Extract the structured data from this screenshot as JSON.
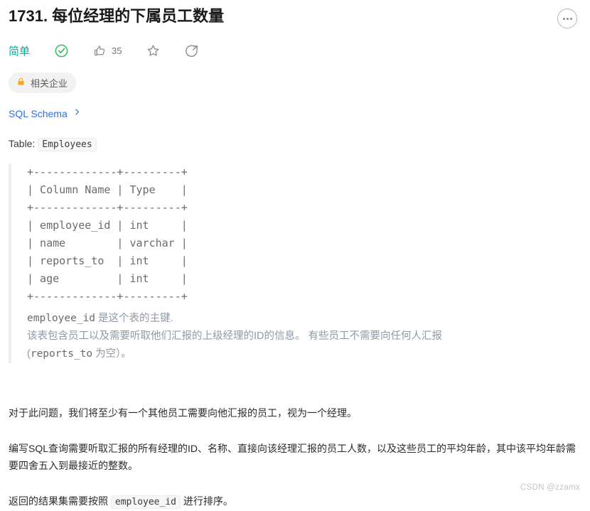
{
  "header": {
    "title": "1731. 每位经理的下属员工数量",
    "more_icon": "more-options-icon"
  },
  "action_bar": {
    "difficulty": "简单",
    "solved_icon": "check-circle-icon",
    "like_icon": "thumbs-up-icon",
    "like_count": "35",
    "favorite_icon": "star-icon",
    "share_icon": "share-icon"
  },
  "company_tag": {
    "lock_icon": "lock-icon",
    "label": "相关企业"
  },
  "schema_link": {
    "label": "SQL Schema",
    "chevron_icon": "chevron-right-icon"
  },
  "table_section": {
    "label": "Table:",
    "table_name": "Employees",
    "ascii_table": "+-------------+---------+\n| Column Name | Type    |\n+-------------+---------+\n| employee_id | int     |\n| name        | varchar |\n| reports_to  | int     |\n| age         | int     |\n+-------------+---------+",
    "note_line1_code": "employee_id",
    "note_line1_text": " 是这个表的主键.",
    "note_line2": "该表包含员工以及需要听取他们汇报的上级经理的ID的信息。  有些员工不需要向任何人汇报",
    "note_line3_prefix": "(",
    "note_line3_code": "reports_to",
    "note_line3_suffix": " 为空）。"
  },
  "description": {
    "paragraph1": "对于此问题，我们将至少有一个其他员工需要向他汇报的员工，视为一个经理。",
    "paragraph2": "编写SQL查询需要听取汇报的所有经理的ID、名称、直接向该经理汇报的员工人数，以及这些员工的平均年龄，其中该平均年龄需要四舍五入到最接近的整数。",
    "paragraph3_prefix": "返回的结果集需要按照 ",
    "paragraph3_code": "employee_id",
    "paragraph3_suffix": " 进行排序。"
  },
  "watermark": "CSDN @zzamx",
  "colors": {
    "difficulty": "#00af9b",
    "link": "#2f6fe0",
    "lock": "#f5a623",
    "solved_check": "#2cbb5d",
    "mono_text": "#6b6b6b",
    "note_text": "#8f9aa6"
  }
}
